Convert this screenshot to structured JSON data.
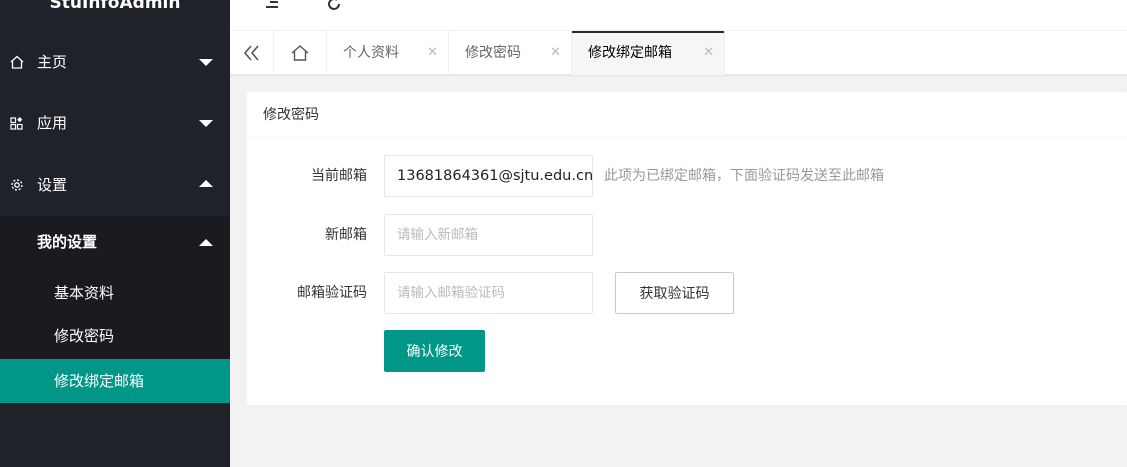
{
  "app": {
    "title": "StuInfoAdmin"
  },
  "sidebar": {
    "menu": [
      {
        "label": "主页",
        "icon": "home-icon",
        "expanded": false
      },
      {
        "label": "应用",
        "icon": "apps-icon",
        "expanded": false
      },
      {
        "label": "设置",
        "icon": "gear-icon",
        "expanded": true
      }
    ],
    "submenu": {
      "label": "我的设置",
      "items": [
        {
          "label": "基本资料"
        },
        {
          "label": "修改密码"
        },
        {
          "label": "修改绑定邮箱",
          "active": true
        }
      ]
    }
  },
  "topbar": {
    "icons": [
      "menu-toggle-icon",
      "refresh-icon"
    ]
  },
  "tabs": {
    "items": [
      {
        "label": "个人资料",
        "closable": true
      },
      {
        "label": "修改密码",
        "closable": true
      },
      {
        "label": "修改绑定邮箱",
        "closable": true,
        "active": true
      }
    ],
    "close_glyph": "✕"
  },
  "form": {
    "card_title": "修改密码",
    "current_email_label": "当前邮箱",
    "current_email_value": "13681864361@sjtu.edu.cn",
    "current_email_hint": "此项为已绑定邮箱，下面验证码发送至此邮箱",
    "new_email_label": "新邮箱",
    "new_email_placeholder": "请输入新邮箱",
    "code_label": "邮箱验证码",
    "code_placeholder": "请输入邮箱验证码",
    "get_code_button": "获取验证码",
    "submit_button": "确认修改"
  },
  "colors": {
    "accent": "#009688",
    "sidebar_bg": "#20222a",
    "sidebar_sub_bg": "#1a1b20"
  }
}
